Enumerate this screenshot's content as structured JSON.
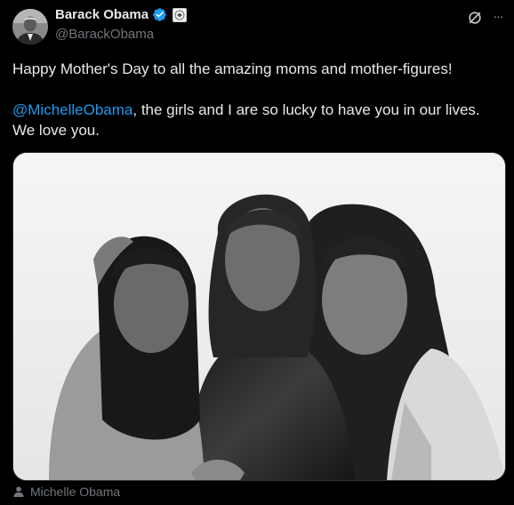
{
  "author": {
    "name": "Barack Obama",
    "handle": "@BarackObama",
    "verified_icon": "verified-badge-icon",
    "affiliation_icon": "presidential-seal-icon"
  },
  "header_actions": {
    "grok_icon": "grok-icon",
    "more_label": "···"
  },
  "tweet": {
    "line1": "Happy Mother's Day to all the amazing moms and mother-figures!",
    "mention": "@MichelleObama",
    "line2_rest": ", the girls and I are so lucky to have you in our lives. We love you."
  },
  "media": {
    "tag_icon": "person-icon",
    "tagged_person": "Michelle Obama"
  },
  "colors": {
    "background": "#000000",
    "text": "#e7e9ea",
    "secondary": "#71767b",
    "accent": "#1d9bf0"
  }
}
